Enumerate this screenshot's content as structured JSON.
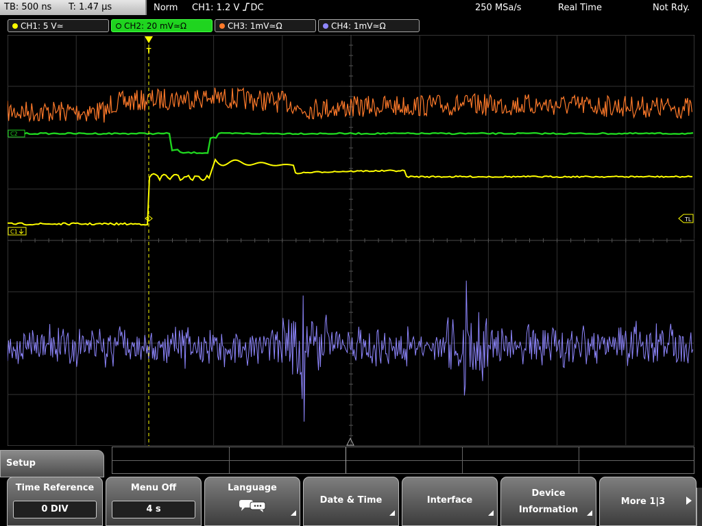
{
  "status": {
    "timebase": "TB: 500 ns",
    "trigger_time": "T: 1.47 µs",
    "mode": "Norm",
    "trigger_source": "CH1: 1.2 V",
    "trigger_coupling": "DC",
    "sample_rate": "250 MSa/s",
    "acquisition": "Real Time",
    "ready_state": "Not Rdy."
  },
  "channels": [
    {
      "label": "CH1: 5 V≃",
      "color": "#ffff00"
    },
    {
      "label": "CH2: 20 mV≃Ω",
      "color": "#1fd41f",
      "active": true
    },
    {
      "label": "CH3: 1mV≃Ω",
      "color": "#ff7a2a"
    },
    {
      "label": "CH4: 1mV≃Ω",
      "color": "#8f87ff"
    }
  ],
  "markers": {
    "ch1": "C1",
    "ch2": "C2",
    "trigger_level": "TL",
    "trigger_pos": "T"
  },
  "menu": {
    "title": "Setup",
    "softkeys": [
      {
        "label": "Time Reference",
        "value": "0 DIV"
      },
      {
        "label": "Menu Off",
        "value": "4 s"
      },
      {
        "label": "Language",
        "icon": "speech-bubbles-icon"
      },
      {
        "label": "Date & Time"
      },
      {
        "label": "Interface"
      },
      {
        "label": "Device",
        "label2": "Information"
      },
      {
        "label": "More 1|3"
      }
    ]
  },
  "colors": {
    "ch1": "#ffff00",
    "ch2": "#1fd41f",
    "ch3": "#ff7a2a",
    "ch4": "#8f87ff",
    "grid": "#3a3a3a",
    "trigger": "#ffff00"
  }
}
